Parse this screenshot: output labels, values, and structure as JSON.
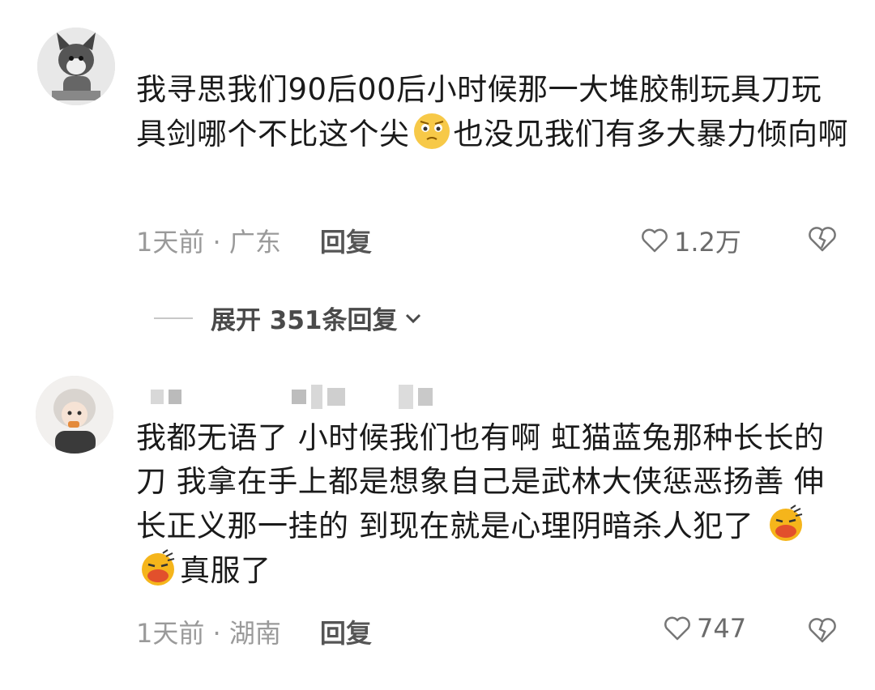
{
  "comments": [
    {
      "text_parts": [
        "我寻思我们90后00后小时候那一大堆胶制玩具刀玩具剑哪个不比这个尖",
        "也没见我们有多大暴力倾向啊"
      ],
      "meta": "1天前 · 广东",
      "reply_label": "回复",
      "likes": "1.2万"
    },
    {
      "text_parts": [
        "我都无语了 小时候我们也有啊 虹猫蓝兔那种长长的刀 我拿在手上都是想象自己是武林大侠惩恶扬善 伸长正义那一挂的 到现在就是心理阴暗杀人犯了 ",
        "真服了"
      ],
      "meta": "1天前 · 湖南",
      "reply_label": "回复",
      "likes": "747"
    }
  ],
  "expand_replies": "展开 351条回复"
}
